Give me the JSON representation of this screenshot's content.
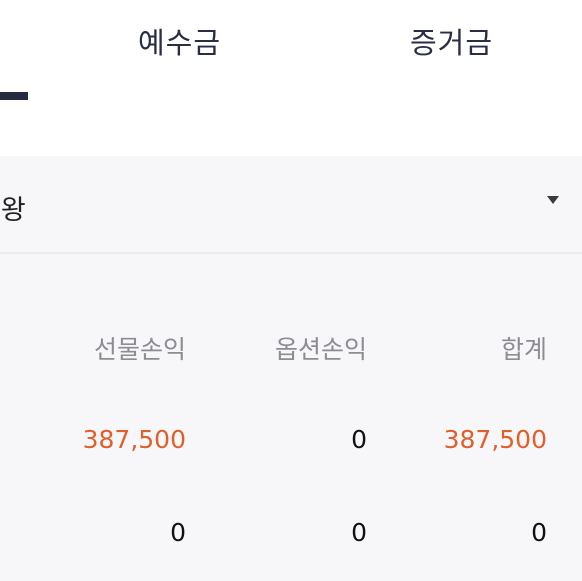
{
  "tabs": [
    {
      "label": "예수금"
    },
    {
      "label": "증거금"
    }
  ],
  "account": {
    "name_visible": "승왕"
  },
  "pnl_table": {
    "headers": [
      "선물손익",
      "옵션손익",
      "합계"
    ],
    "rows": [
      {
        "futures": "387,500",
        "options": "0",
        "total": "387,500"
      },
      {
        "futures": "0",
        "options": "0",
        "total": "0"
      }
    ]
  },
  "colors": {
    "profit": "#e0602b",
    "tab_indicator": "#262a40",
    "panel_bg": "#f7f7f9"
  },
  "icons": {
    "dropdown": "caret-down-icon"
  }
}
